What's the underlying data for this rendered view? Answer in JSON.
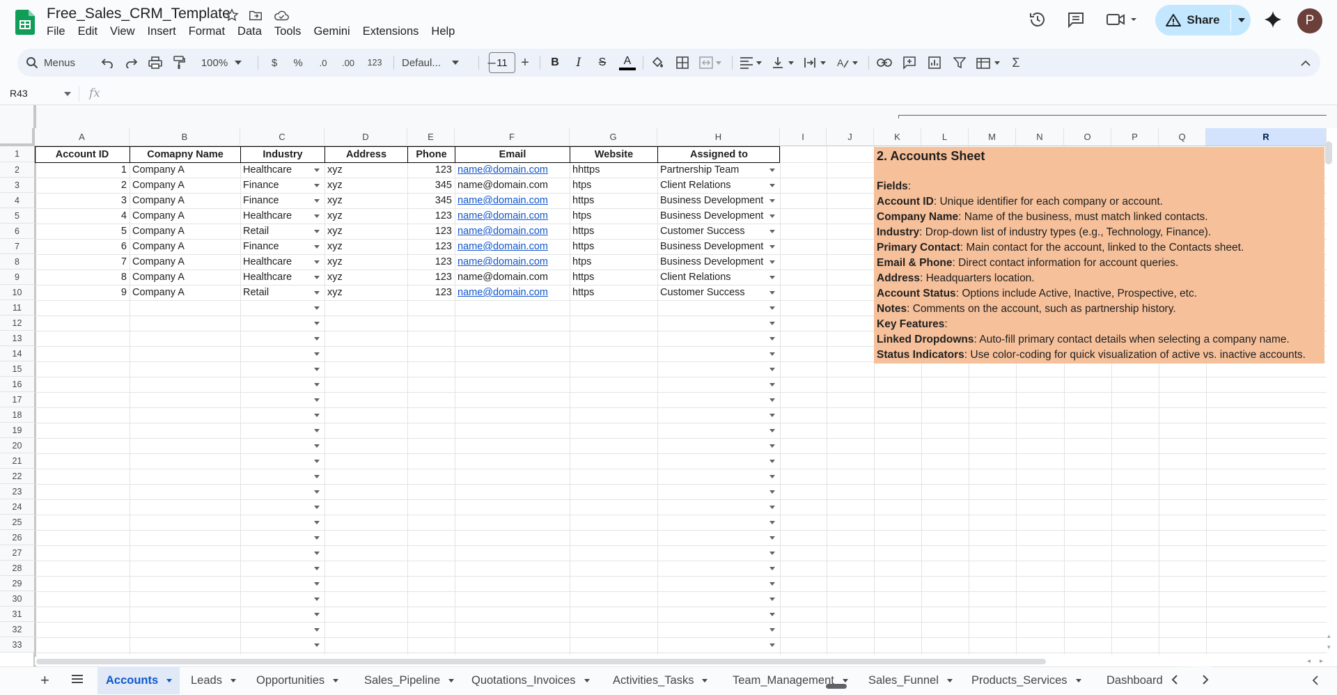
{
  "app": {
    "doc_title": "Free_Sales_CRM_Template",
    "menu": [
      "File",
      "Edit",
      "View",
      "Insert",
      "Format",
      "Data",
      "Tools",
      "Gemini",
      "Extensions",
      "Help"
    ],
    "share_label": "Share",
    "avatar_initial": "P",
    "brand_color": "#0f9d58",
    "accent_color": "#c2e7ff"
  },
  "toolbar": {
    "menus_label": "Menus",
    "zoom": "100%",
    "currency": "$",
    "percent": "%",
    "dec_decrease": ".0",
    "dec_increase": ".00",
    "number_format": "123",
    "font": "Defaul...",
    "font_size": "11"
  },
  "formula_bar": {
    "cell_ref": "R43",
    "fx": "fx",
    "value": ""
  },
  "grid": {
    "columns": [
      "A",
      "B",
      "C",
      "D",
      "E",
      "F",
      "G",
      "H",
      "I",
      "J",
      "K",
      "L",
      "M",
      "N",
      "O",
      "P",
      "Q",
      "R"
    ],
    "selected_column": "R",
    "row_numbers": [
      "1",
      "2",
      "3",
      "4",
      "5",
      "6",
      "7",
      "8",
      "9",
      "10",
      "11",
      "12",
      "13",
      "14",
      "15",
      "16",
      "17",
      "18",
      "19",
      "20",
      "21",
      "22",
      "23",
      "24",
      "25",
      "26",
      "27",
      "28",
      "29",
      "30",
      "31",
      "32",
      "33"
    ],
    "headers": [
      "Account ID",
      "Comapny Name",
      "Industry",
      "Address",
      "Phone",
      "Email",
      "Website",
      "Assigned to"
    ],
    "rows": [
      [
        "1",
        "Company A",
        "Healthcare",
        "xyz",
        "123",
        "name@domain.com",
        "hhttps",
        "Partnership Team"
      ],
      [
        "2",
        "Company A",
        "Finance",
        "xyz",
        "345",
        "name@domain.com",
        "htps",
        "Client Relations"
      ],
      [
        "3",
        "Company A",
        "Finance",
        "xyz",
        "345",
        "name@domain.com",
        "https",
        "Business Development"
      ],
      [
        "4",
        "Company A",
        "Healthcare",
        "xyz",
        "123",
        "name@domain.com",
        "htps",
        "Business Development"
      ],
      [
        "5",
        "Company A",
        "Retail",
        "xyz",
        "123",
        "name@domain.com",
        "https",
        "Customer Success"
      ],
      [
        "6",
        "Company A",
        "Finance",
        "xyz",
        "123",
        "name@domain.com",
        "https",
        "Business Development"
      ],
      [
        "7",
        "Company A",
        "Healthcare",
        "xyz",
        "123",
        "name@domain.com",
        "htps",
        "Business Development"
      ],
      [
        "8",
        "Company A",
        "Healthcare",
        "xyz",
        "123",
        "name@domain.com",
        "https",
        "Client Relations"
      ],
      [
        "9",
        "Company A",
        "Retail",
        "xyz",
        "123",
        "name@domain.com",
        "https",
        "Customer Success"
      ]
    ],
    "email_linked": [
      true,
      false,
      true,
      true,
      true,
      true,
      true,
      false,
      true
    ]
  },
  "notes": {
    "color": "#f6c09a",
    "title": "2. Accounts Sheet",
    "fields_label": "Fields",
    "lines": [
      {
        "key": "Account ID",
        "text": "Unique identifier for each company or account."
      },
      {
        "key": "Company Name",
        "text": "Name of the business, must match linked contacts."
      },
      {
        "key": "Industry",
        "text": "Drop-down list of industry types (e.g., Technology, Finance)."
      },
      {
        "key": "Primary Contact",
        "text": "Main contact for the account, linked to the Contacts sheet."
      },
      {
        "key": "Email & Phone",
        "text": "Direct contact information for account queries."
      },
      {
        "key": "Address",
        "text": "Headquarters location."
      },
      {
        "key": "Account Status",
        "text": "Options include Active, Inactive, Prospective, etc."
      },
      {
        "key": "Notes",
        "text": "Comments on the account, such as partnership history."
      }
    ],
    "key_features_label": "Key Features",
    "features": [
      {
        "key": "Linked Dropdowns",
        "text": "Auto-fill primary contact details when selecting a company name."
      },
      {
        "key": "Status Indicators",
        "text": "Use color-coding for quick visualization of active vs. inactive accounts."
      }
    ]
  },
  "sheets": {
    "active": "Accounts",
    "tabs": [
      "Accounts",
      "Leads",
      "Opportunities",
      "Sales_Pipeline",
      "Quotations_Invoices",
      "Activities_Tasks",
      "Team_Management",
      "Sales_Funnel",
      "Products_Services",
      "Dashboard"
    ]
  }
}
